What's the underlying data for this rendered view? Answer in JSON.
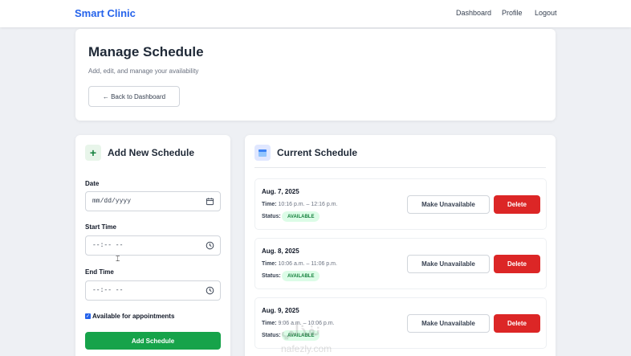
{
  "nav": {
    "brand": "Smart Clinic",
    "links": [
      "Dashboard",
      "Profile",
      "Logout"
    ]
  },
  "header": {
    "title": "Manage Schedule",
    "subtitle": "Add, edit, and manage your availability",
    "back_label": "← Back to Dashboard"
  },
  "add_form": {
    "icon": "plus-icon",
    "title": "Add New Schedule",
    "date_label": "Date",
    "date_placeholder": "mm/dd/yyyy",
    "start_label": "Start Time",
    "start_placeholder": "--:-- --",
    "end_label": "End Time",
    "end_placeholder": "--:-- --",
    "available_label": "Available for appointments",
    "available_checked": true,
    "submit_label": "Add Schedule"
  },
  "schedule": {
    "icon": "calendar-icon",
    "title": "Current Schedule",
    "time_label": "Time:",
    "status_label": "Status:",
    "make_unavailable_label": "Make Unavailable",
    "delete_label": "Delete",
    "items": [
      {
        "date": "Aug. 7, 2025",
        "time": "10:16 p.m. – 12:16 p.m.",
        "status": "AVAILABLE"
      },
      {
        "date": "Aug. 8, 2025",
        "time": "10:06 a.m. – 11:06 p.m.",
        "status": "AVAILABLE"
      },
      {
        "date": "Aug. 9, 2025",
        "time": "9:06 a.m. – 10:06 p.m.",
        "status": "AVAILABLE"
      }
    ]
  },
  "watermark": {
    "text": "نفذلي",
    "sub": "nafezly.com"
  },
  "colors": {
    "brand": "#2563eb",
    "primary_action": "#16a34a",
    "danger": "#dc2626",
    "available_badge_bg": "#dcfce7",
    "available_badge_text": "#15803d"
  }
}
